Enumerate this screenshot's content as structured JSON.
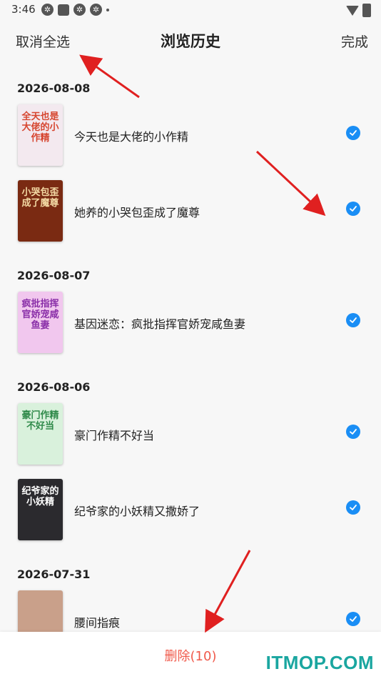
{
  "status_bar": {
    "time": "3:46"
  },
  "header": {
    "left_action": "取消全选",
    "title": "浏览历史",
    "right_action": "完成"
  },
  "groups": [
    {
      "date": "2026-08-08",
      "items": [
        {
          "title": "今天也是大佬的小作精",
          "cover_text": "全天也是大佬的小作精",
          "cover_bg": "#f3e9ef",
          "cover_fg": "#d6452f"
        },
        {
          "title": "她养的小哭包歪成了魔尊",
          "cover_text": "小哭包歪成了魔尊",
          "cover_bg": "#7a2a12",
          "cover_fg": "#f3d9a4"
        }
      ]
    },
    {
      "date": "2026-08-07",
      "items": [
        {
          "title": "基因迷恋：疯批指挥官娇宠咸鱼妻",
          "cover_text": "疯批指挥官娇宠咸鱼妻",
          "cover_bg": "#f1c7ee",
          "cover_fg": "#8a2fa8"
        }
      ]
    },
    {
      "date": "2026-08-06",
      "items": [
        {
          "title": "豪门作精不好当",
          "cover_text": "豪门作精不好当",
          "cover_bg": "#d9f1dc",
          "cover_fg": "#2f8a4a"
        },
        {
          "title": "纪爷家的小妖精又撒娇了",
          "cover_text": "纪爷家的小妖精",
          "cover_bg": "#2b2a2e",
          "cover_fg": "#ffffff"
        }
      ]
    },
    {
      "date": "2026-07-31",
      "items": [
        {
          "title": "腰间指痕",
          "cover_text": "",
          "cover_bg": "#c9a08a",
          "cover_fg": "#ffffff"
        }
      ]
    }
  ],
  "bottom_bar": {
    "delete_label": "删除(10)",
    "watermark": "ITMOP.COM"
  },
  "colors": {
    "accent": "#1a8ef5",
    "danger": "#f05a4b",
    "watermark": "#1aa6a0"
  }
}
